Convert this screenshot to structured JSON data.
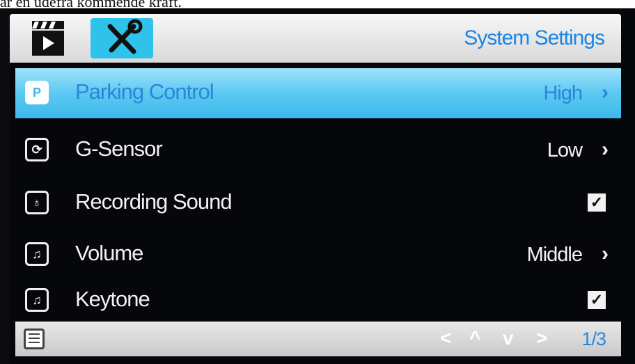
{
  "caption": "ar en udefra kommende kraft.",
  "header": {
    "title": "System Settings",
    "tabs": [
      {
        "icon": "video-clapper-icon",
        "label": ""
      },
      {
        "icon": "tools-icon",
        "label": ""
      }
    ]
  },
  "menu": {
    "items": [
      {
        "label": "Parking Control",
        "value": "High",
        "icon": "parking-icon",
        "type": "submenu"
      },
      {
        "label": "G-Sensor",
        "value": "Low",
        "icon": "g-sensor-icon",
        "type": "submenu"
      },
      {
        "label": "Recording Sound",
        "value": "✓",
        "icon": "microphone-icon",
        "type": "checkbox"
      },
      {
        "label": "Volume",
        "value": "Middle",
        "icon": "music-note-icon",
        "type": "submenu"
      },
      {
        "label": "Keytone",
        "value": "✓",
        "icon": "music-note-icon",
        "type": "checkbox"
      }
    ]
  },
  "footer": {
    "page": "1/3",
    "nav": [
      "<",
      "^",
      "v",
      ">"
    ]
  },
  "colors": {
    "accent": "#3db8ea",
    "title_blue": "#1a86e5",
    "background": "#06070b"
  }
}
